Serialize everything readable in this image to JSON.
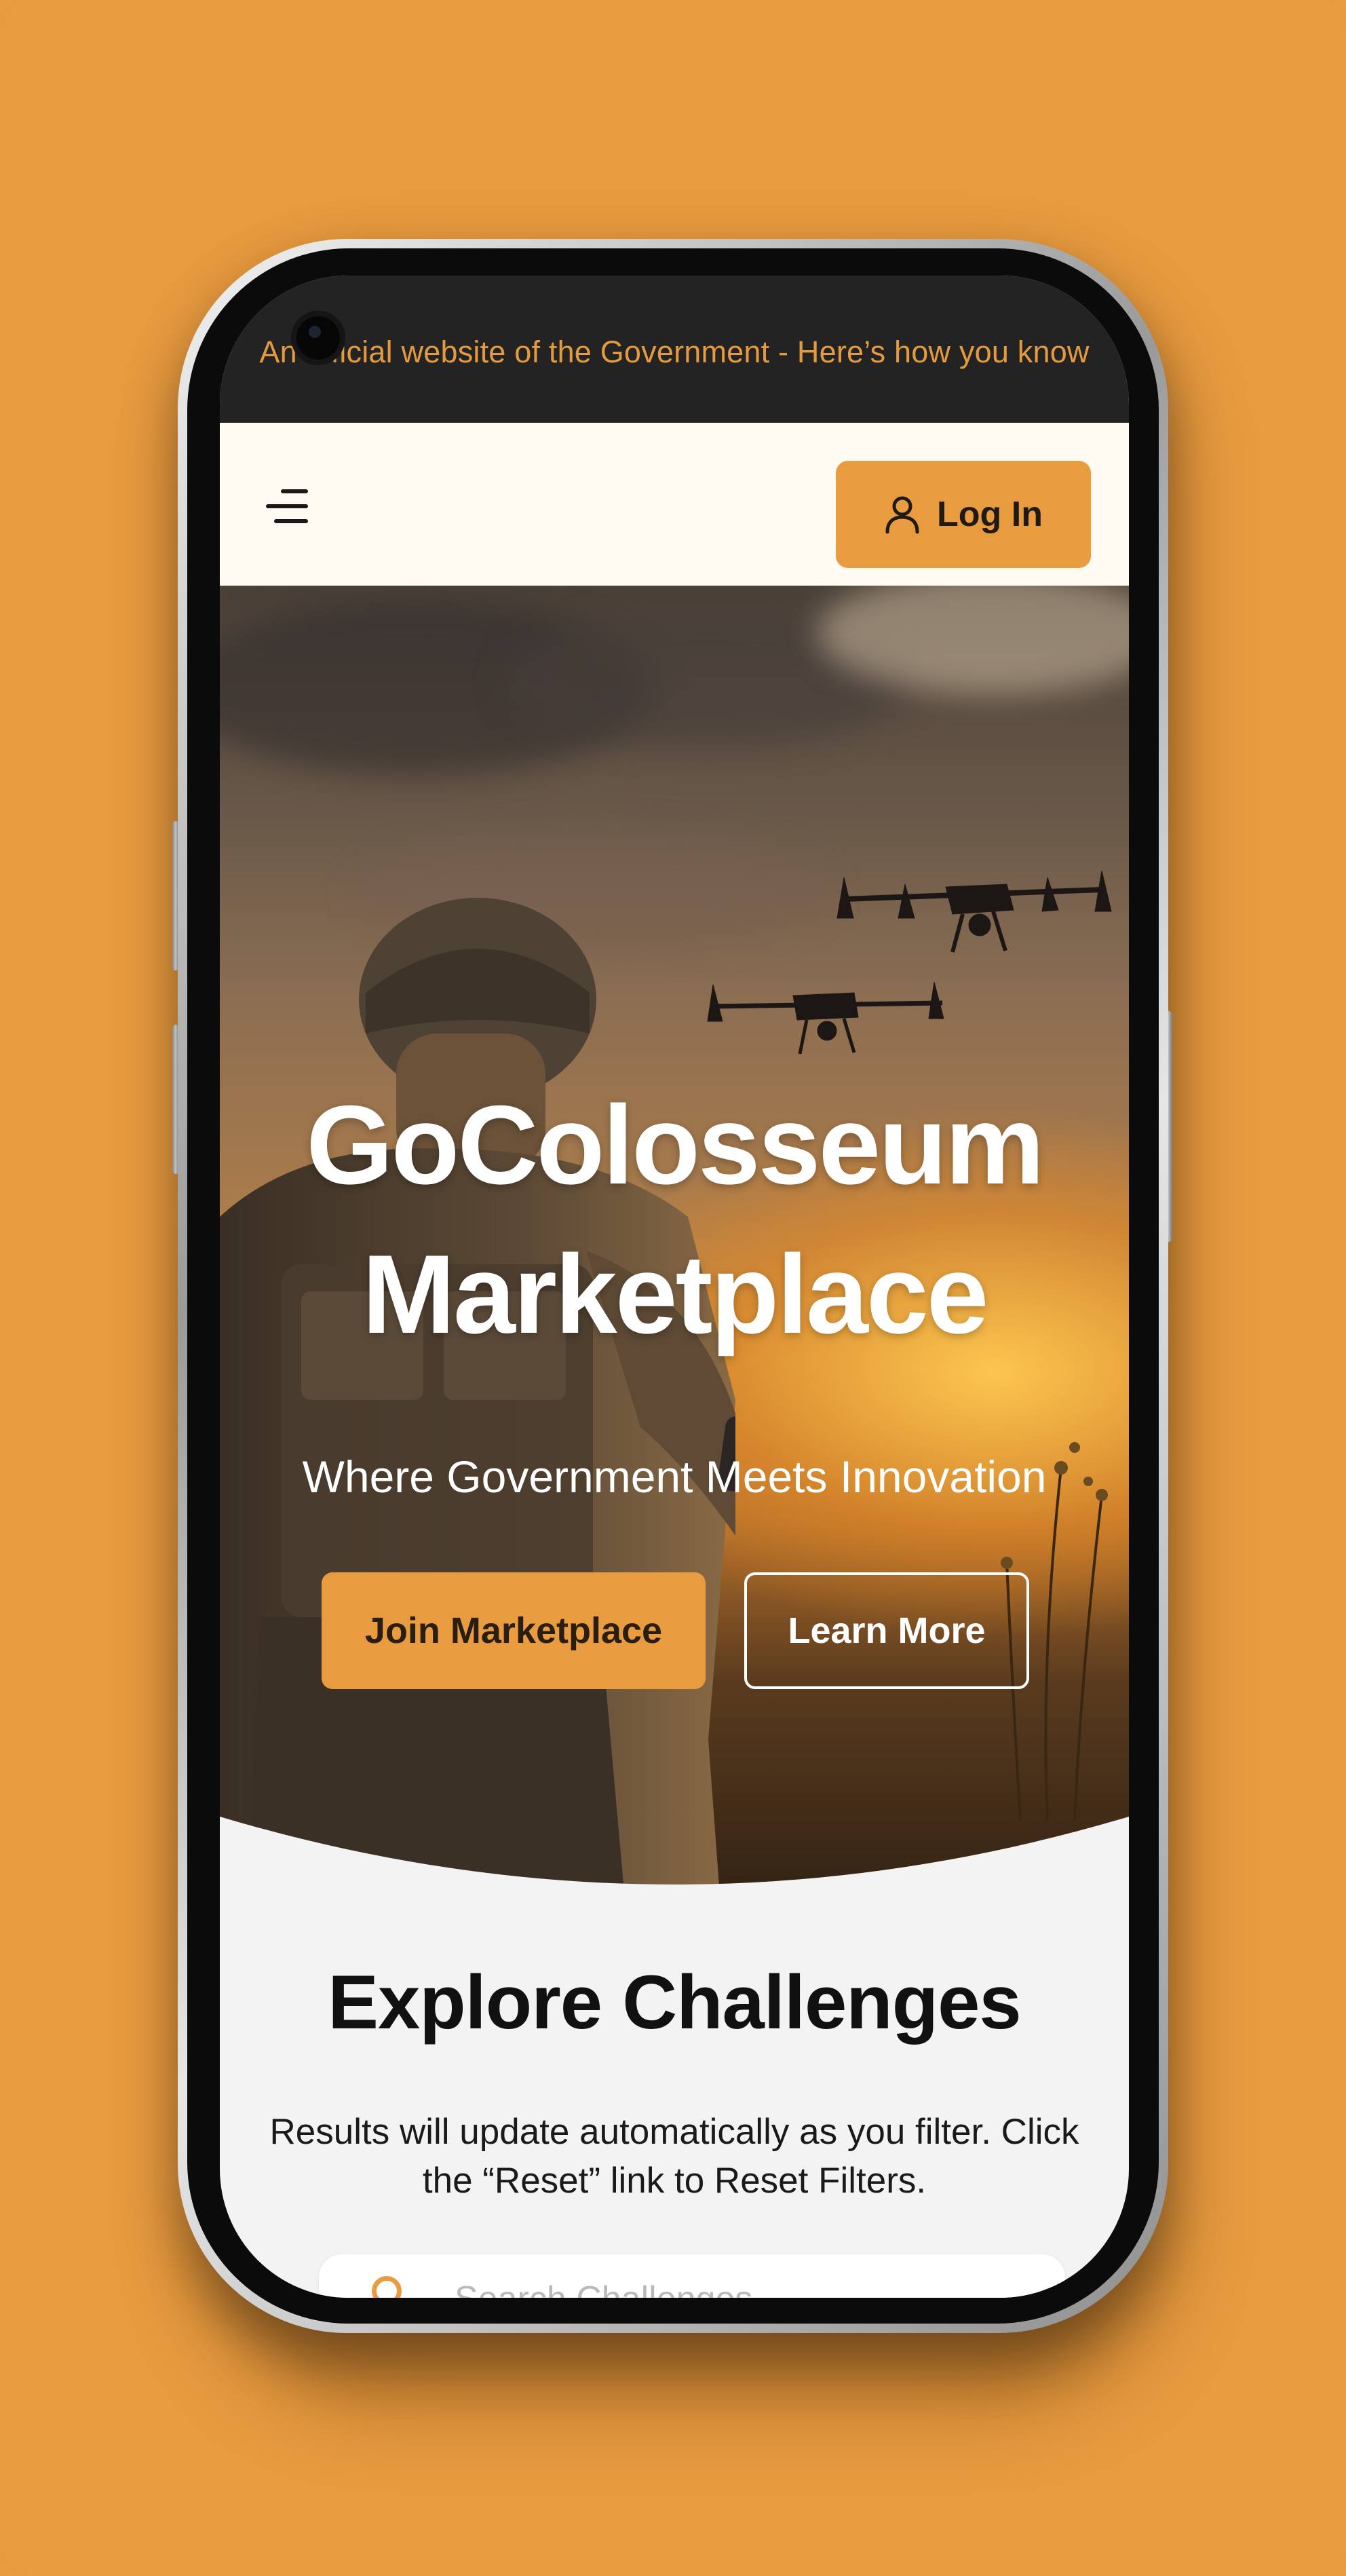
{
  "colors": {
    "background": "#E89B3F",
    "accent": "#E89B3F",
    "banner_bg": "#232323",
    "banner_text": "#E49A3E",
    "header_bg": "#FFFBF2",
    "content_bg": "#F3F3F3"
  },
  "gov_banner": {
    "text": "An official website of the Government - Here’s how you know"
  },
  "header": {
    "menu_icon": "hamburger-menu-icon",
    "login_icon": "user-icon",
    "login_label": "Log In"
  },
  "hero": {
    "title_line1": "GoColosseum",
    "title_line2": "Marketplace",
    "subtitle": "Where Government Meets Innovation",
    "primary_cta": "Join Marketplace",
    "secondary_cta": "Learn More"
  },
  "explore": {
    "title": "Explore Challenges",
    "description": "Results will update automatically as you filter. Click the “Reset” link to Reset Filters.",
    "search_placeholder": "Search Challenges",
    "search_icon": "search-icon"
  }
}
